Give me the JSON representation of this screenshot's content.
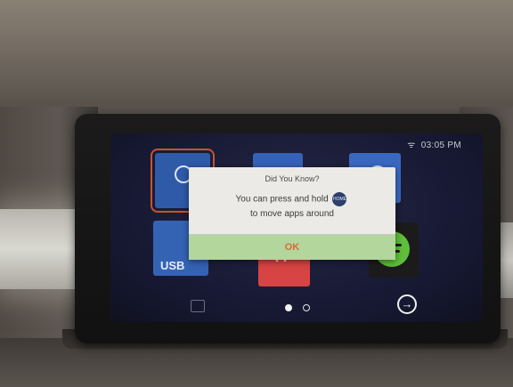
{
  "status_bar": {
    "time": "03:05 PM",
    "wifi_icon": "wifi-icon"
  },
  "apps": [
    {
      "name": "app-tile-1",
      "color": "#2f5aa8"
    },
    {
      "name": "app-tile-2",
      "color": "#3562b8"
    },
    {
      "name": "app-tile-3",
      "color": "#3a68c0"
    },
    {
      "name": "usb",
      "label": "USB",
      "color": "#3563b4"
    },
    {
      "name": "app-tile-red",
      "color": "#d84444"
    },
    {
      "name": "spotify",
      "color": "#1b1b1b",
      "accent": "#5fbf3a"
    }
  ],
  "dialog": {
    "title": "Did You Know?",
    "body_line1_prefix": "You can press and hold",
    "hold_badge": "HOME",
    "body_line2": "to move apps around",
    "ok_label": "OK",
    "ok_color": "#b3d69d",
    "ok_text_color": "#d86c3a"
  },
  "pager": {
    "pages": 2,
    "current_page": 1
  },
  "nav": {
    "next_icon": "arrow-right-circle-icon",
    "home_icon": "home-icon"
  }
}
